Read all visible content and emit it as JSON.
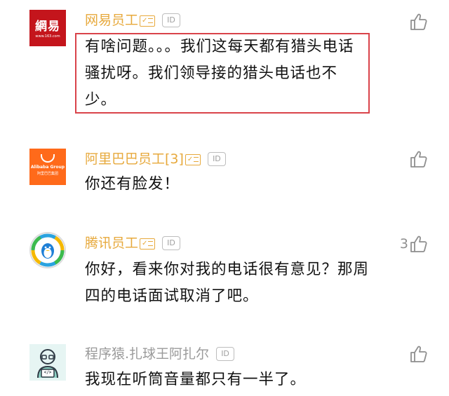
{
  "comments": [
    {
      "avatar": "netease-logo",
      "avatar_text": "網易",
      "avatar_subtext": "www.163.com",
      "name": "网易员工",
      "name_color": "#e7a93c",
      "verified": true,
      "id_badge": "ID",
      "text": "有啥问题。。。我们这每天都有猎头电话骚扰呀。我们领导接的猎头电话也不少。",
      "highlighted": true,
      "highlight_color": "#d9434a",
      "likes": ""
    },
    {
      "avatar": "alibaba-logo",
      "avatar_text": "Alibaba Group",
      "avatar_subtext": "阿里巴巴集团",
      "name": "阿里巴巴员工[3]",
      "name_color": "#e7a93c",
      "verified": true,
      "id_badge": "ID",
      "text": "你还有脸发！",
      "highlighted": false,
      "likes": ""
    },
    {
      "avatar": "tencent-penguin-logo",
      "name": "腾讯员工",
      "name_color": "#e7a93c",
      "verified": true,
      "id_badge": "ID",
      "text": "你好，看来你对我的电话很有意见？那周四的电话面试取消了吧。",
      "highlighted": false,
      "likes": "3"
    },
    {
      "avatar": "programmer-avatar",
      "avatar_text": "</>",
      "name": "程序猿.扎球王阿扎尔",
      "name_color": "#9a9a9a",
      "verified": false,
      "id_badge": "ID",
      "text": "我现在听筒音量都只有一半了。",
      "highlighted": false,
      "likes": ""
    }
  ],
  "icons": {
    "like": "thumbs-up-icon",
    "verify": "verified-badge-icon"
  }
}
